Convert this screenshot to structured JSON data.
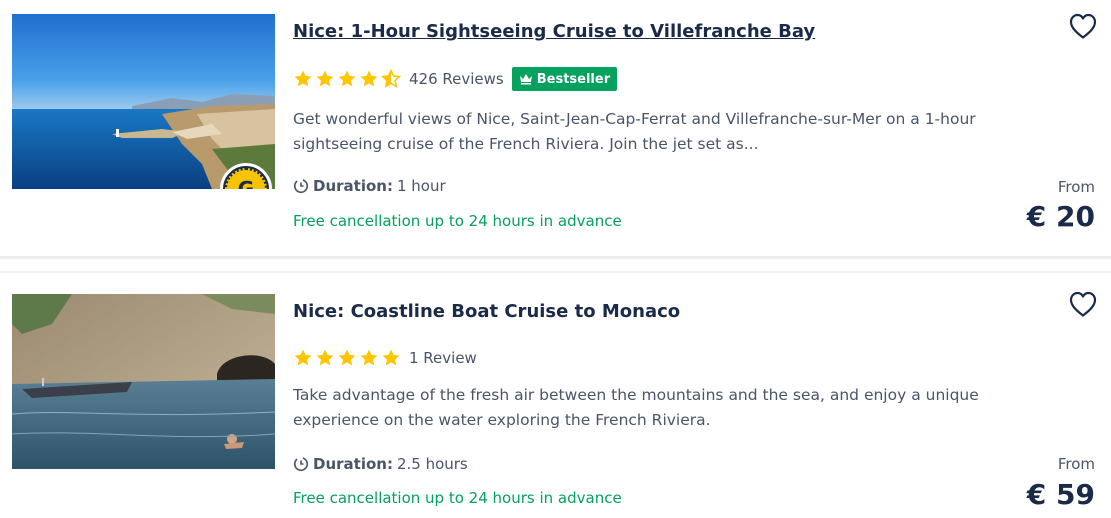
{
  "colors": {
    "title": "#1a2b49",
    "star": "#fdc600",
    "green": "#04a15f",
    "muted": "#4a5568"
  },
  "activities": [
    {
      "title": "Nice: 1-Hour Sightseeing Cruise to Villefranche Bay",
      "rating": 4.5,
      "reviews": "426 Reviews",
      "badge": "Bestseller",
      "description_line1": "Get wonderful views of Nice, Saint-Jean-Cap-Ferrat and Villefranche-sur-Mer on a 1-hour",
      "description_line2": "sightseeing cruise of the French Riviera. Join the jet set as...",
      "duration_label": "Duration:",
      "duration_value": "1 hour",
      "cancellation": "Free cancellation up to 24 hours in advance",
      "from_label": "From",
      "price": "€ 20",
      "badge_letter": "G",
      "icons": [
        "heart-icon",
        "clock-icon",
        "crown-icon",
        "star-icon"
      ]
    },
    {
      "title": "Nice: Coastline Boat Cruise to Monaco",
      "rating": 5,
      "reviews": "1 Review",
      "description_line1": "Take advantage of the fresh air between the mountains and the sea, and enjoy a unique",
      "description_line2": "experience on the water exploring the French Riviera.",
      "duration_label": "Duration:",
      "duration_value": "2.5 hours",
      "cancellation": "Free cancellation up to 24 hours in advance",
      "from_label": "From",
      "price": "€ 59",
      "icons": [
        "heart-icon",
        "clock-icon",
        "star-icon"
      ]
    }
  ]
}
